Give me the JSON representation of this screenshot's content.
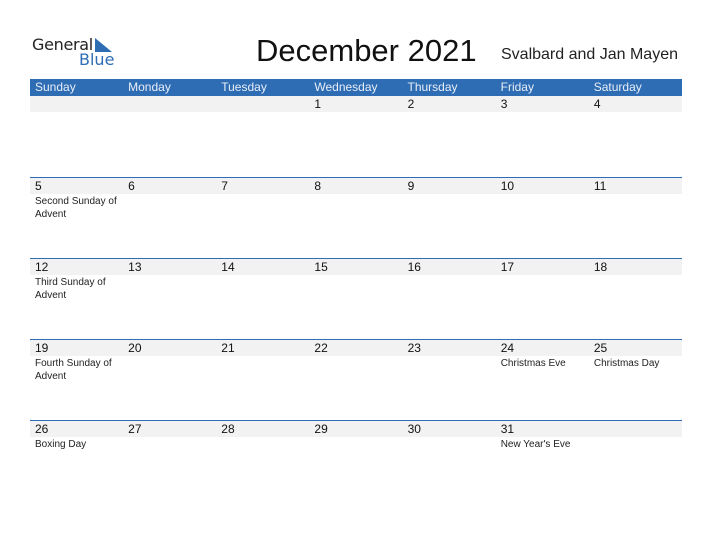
{
  "brand": {
    "general": "General",
    "blue": "Blue",
    "accent": "#2e6db4"
  },
  "title": "December 2021",
  "region": "Svalbard and Jan Mayen",
  "weekdays": [
    "Sunday",
    "Monday",
    "Tuesday",
    "Wednesday",
    "Thursday",
    "Friday",
    "Saturday"
  ],
  "weeks": [
    {
      "days": [
        {
          "num": "",
          "event": ""
        },
        {
          "num": "",
          "event": ""
        },
        {
          "num": "",
          "event": ""
        },
        {
          "num": "1",
          "event": ""
        },
        {
          "num": "2",
          "event": ""
        },
        {
          "num": "3",
          "event": ""
        },
        {
          "num": "4",
          "event": ""
        }
      ]
    },
    {
      "days": [
        {
          "num": "5",
          "event": "Second Sunday of Advent"
        },
        {
          "num": "6",
          "event": ""
        },
        {
          "num": "7",
          "event": ""
        },
        {
          "num": "8",
          "event": ""
        },
        {
          "num": "9",
          "event": ""
        },
        {
          "num": "10",
          "event": ""
        },
        {
          "num": "11",
          "event": ""
        }
      ]
    },
    {
      "days": [
        {
          "num": "12",
          "event": "Third Sunday of Advent"
        },
        {
          "num": "13",
          "event": ""
        },
        {
          "num": "14",
          "event": ""
        },
        {
          "num": "15",
          "event": ""
        },
        {
          "num": "16",
          "event": ""
        },
        {
          "num": "17",
          "event": ""
        },
        {
          "num": "18",
          "event": ""
        }
      ]
    },
    {
      "days": [
        {
          "num": "19",
          "event": "Fourth Sunday of Advent"
        },
        {
          "num": "20",
          "event": ""
        },
        {
          "num": "21",
          "event": ""
        },
        {
          "num": "22",
          "event": ""
        },
        {
          "num": "23",
          "event": ""
        },
        {
          "num": "24",
          "event": "Christmas Eve"
        },
        {
          "num": "25",
          "event": "Christmas Day"
        }
      ]
    },
    {
      "days": [
        {
          "num": "26",
          "event": "Boxing Day"
        },
        {
          "num": "27",
          "event": ""
        },
        {
          "num": "28",
          "event": ""
        },
        {
          "num": "29",
          "event": ""
        },
        {
          "num": "30",
          "event": ""
        },
        {
          "num": "31",
          "event": "New Year's Eve"
        },
        {
          "num": "",
          "event": ""
        }
      ]
    }
  ]
}
